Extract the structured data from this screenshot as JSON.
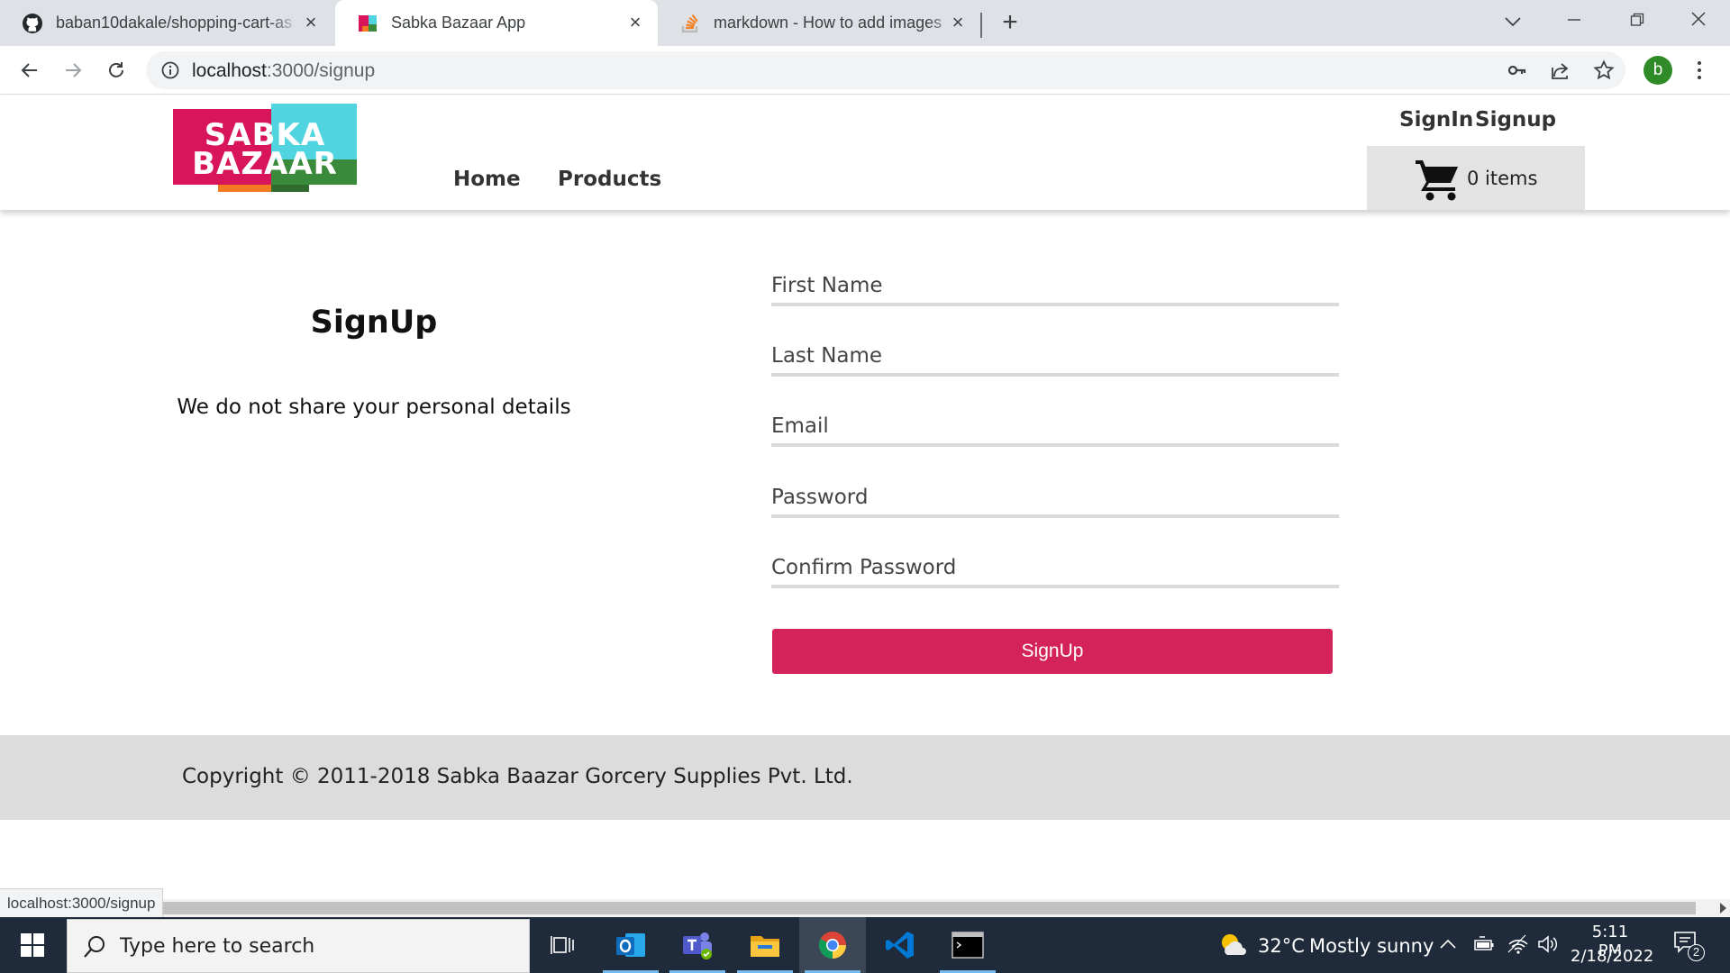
{
  "browser": {
    "tabs": [
      {
        "title": "baban10dakale/shopping-cart-as",
        "icon": "github-icon",
        "active": false
      },
      {
        "title": "Sabka Bazaar App",
        "icon": "site-favicon",
        "active": true
      },
      {
        "title": "markdown - How to add images",
        "icon": "stackoverflow-icon",
        "active": false
      }
    ],
    "url_host": "localhost",
    "url_path": ":3000/signup",
    "profile_initial": "b"
  },
  "site": {
    "logo": {
      "line1": "SABKA",
      "line2": "BAZAAR"
    },
    "nav": {
      "home": "Home",
      "products": "Products"
    },
    "auth": {
      "signin": "SignIn",
      "signup": "Signup"
    },
    "cart": {
      "label": "0 items"
    }
  },
  "signup": {
    "title": "SignUp",
    "note": "We do not share your personal details",
    "fields": [
      {
        "placeholder": "First Name"
      },
      {
        "placeholder": "Last Name"
      },
      {
        "placeholder": "Email"
      },
      {
        "placeholder": "Password"
      },
      {
        "placeholder": "Confirm Password"
      }
    ],
    "submit_label": "SignUp"
  },
  "footer": {
    "copyright": "Copyright © 2011-2018 Sabka Baazar Gorcery Supplies Pvt. Ltd."
  },
  "status_tooltip": "localhost:3000/signup",
  "taskbar": {
    "search_placeholder": "Type here to search",
    "weather": {
      "temp": "32°C",
      "condition": "Mostly sunny"
    },
    "time": "5:11 PM",
    "date": "2/18/2022",
    "notifications": "2"
  },
  "colors": {
    "accent": "#d4235b",
    "logo_pink": "#d8155b",
    "logo_cyan": "#50d5e0",
    "logo_orange": "#f37a22",
    "logo_green": "#3a8a3c",
    "taskbar": "#1f2b3a"
  }
}
